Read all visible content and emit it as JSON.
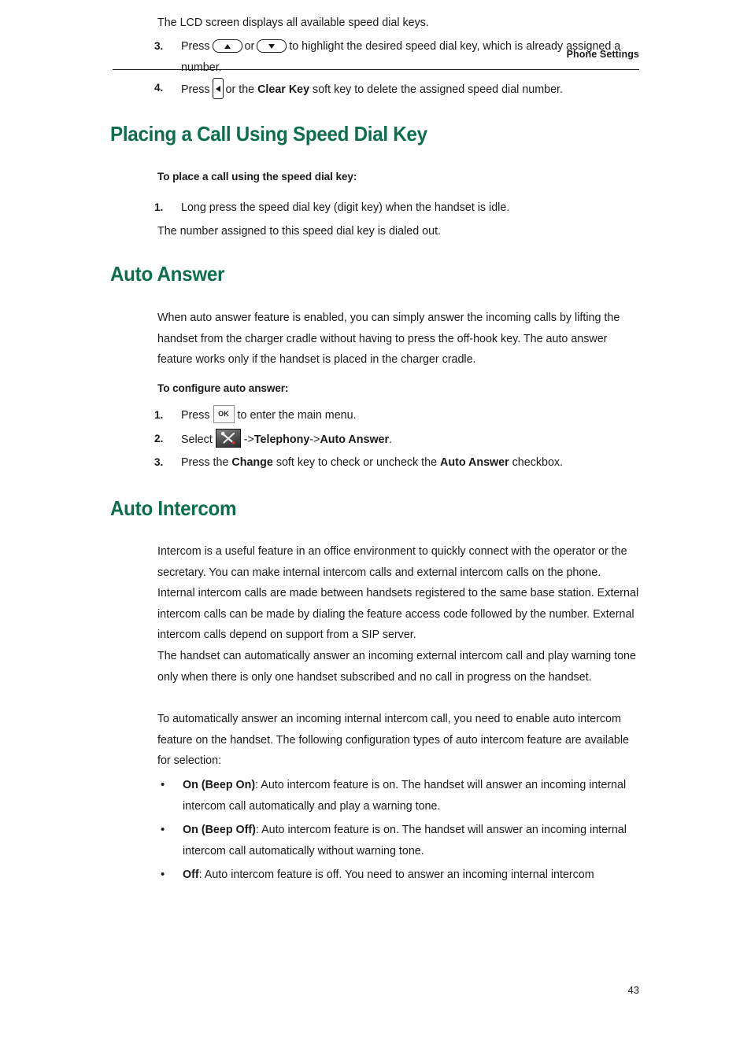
{
  "page": {
    "header_title": "Phone Settings",
    "page_number": "43",
    "heading_color": "#0d6e4a",
    "text_color": "#1a1a1a",
    "background": "#ffffff"
  },
  "intro": {
    "lcd_note": "The LCD screen displays all available speed dial keys.",
    "step3": {
      "number": "3.",
      "text_before": "Press",
      "icon_up": "nav-up-key-icon",
      "text_or": "or",
      "icon_down": "nav-down-key-icon",
      "text_after": "to highlight the desired speed dial key, which is already assigned a number."
    },
    "step4": {
      "number": "4.",
      "text_before": "Press",
      "icon_clear": "clear-key-icon",
      "text_mid_1": "or the",
      "bold_clear_key": "Clear Key",
      "text_after": "soft key to delete the assigned speed dial number."
    }
  },
  "section_placing": {
    "heading": "Placing a Call Using Speed Dial Key",
    "subheading": "To place a call using the speed dial key:",
    "step1": {
      "number": "1.",
      "text": "Long press the speed dial key (digit key) when the handset is idle."
    },
    "result": "The number assigned to this speed dial key is dialed out."
  },
  "section_auto_answer": {
    "heading": "Auto Answer",
    "paragraph": "When auto answer feature is enabled, you can simply answer the incoming calls by lifting the handset from the charger cradle without having to press the off-hook key. The auto answer feature works only if the handset is placed in the charger cradle.",
    "subheading": "To configure auto answer:",
    "step1": {
      "number": "1.",
      "text_before": "Press",
      "icon_ok": "ok-key-icon",
      "ok_label": "OK",
      "text_after": "to enter the main menu."
    },
    "step2": {
      "number": "2.",
      "text_before": "Select",
      "icon_settings": "settings-tools-icon",
      "path_arrow_1": "->",
      "path_item_1": "Telephony",
      "path_arrow_2": "->",
      "path_item_2": "Auto Answer",
      "text_after": "."
    },
    "step3": {
      "number": "3.",
      "text_before": "Press the",
      "bold_change": "Change",
      "text_mid": "soft key to check or uncheck the",
      "bold_auto_answer": "Auto Answer",
      "text_after": "checkbox."
    }
  },
  "section_auto_intercom": {
    "heading": "Auto Intercom",
    "paragraph_1": "Intercom is a useful feature in an office environment to quickly connect with the operator or the secretary. You can make internal intercom calls and external intercom calls on the phone. Internal intercom calls are made between handsets registered to the same base station. External intercom calls can be made by dialing the feature access code followed by the number. External intercom calls depend on support from a SIP server.",
    "paragraph_2": "The handset can automatically answer an incoming external intercom call and play warning tone only when there is only one handset subscribed and no call in progress on the handset.",
    "paragraph_3": "To automatically answer an incoming internal intercom call, you need to enable auto intercom feature on the handset. The following configuration types of auto intercom feature are available for selection:",
    "bullets": [
      {
        "marker": "•",
        "term": "On (Beep On)",
        "description": ": Auto intercom feature is on. The handset will answer an incoming internal intercom call automatically and play a warning tone."
      },
      {
        "marker": "•",
        "term": "On (Beep Off)",
        "description": ": Auto intercom feature is on. The handset will answer an incoming internal intercom call automatically without warning tone."
      },
      {
        "marker": "•",
        "term": "Off",
        "description": ": Auto intercom feature is off. You need to answer an incoming internal intercom"
      }
    ]
  }
}
